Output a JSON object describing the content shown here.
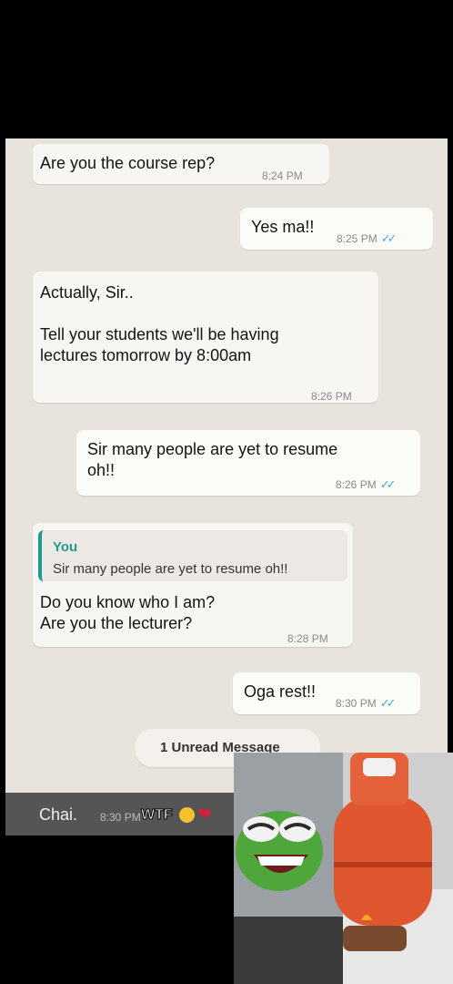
{
  "messages": [
    {
      "side": "in",
      "text": "Are you the course rep?",
      "time": "8:24 PM"
    },
    {
      "side": "out",
      "text": "Yes ma!!",
      "time": "8:25 PM",
      "ticks": "✓✓"
    },
    {
      "side": "in",
      "text": "Actually, Sir..\n\nTell your students we'll be having\nlectures tomorrow by 8:00am",
      "time": "8:26 PM"
    },
    {
      "side": "out",
      "text": "Sir many people are yet to resume\noh!!",
      "time": "8:26 PM",
      "ticks": "✓✓"
    },
    {
      "side": "in",
      "quote_author": "You",
      "quote_text": "Sir many people are yet to resume oh!!",
      "text": "Do you know who I am?\nAre you the lecturer?",
      "time": "8:28 PM"
    },
    {
      "side": "out",
      "text": "Oga rest!!",
      "time": "8:30 PM",
      "ticks": "✓✓"
    }
  ],
  "unread_banner": "1 Unread Message",
  "last_message": {
    "text": "Chai.",
    "time": "8:30 PM"
  },
  "overlay_text": "WTF",
  "meme": {
    "description_icon": "pepe-frog-laughing-icon",
    "cylinder_icon": "gas-cylinder-icon"
  },
  "colors": {
    "accent": "#1f9c8f",
    "ticks": "#4fa8e0",
    "chat_bg": "#e8e3dc"
  }
}
